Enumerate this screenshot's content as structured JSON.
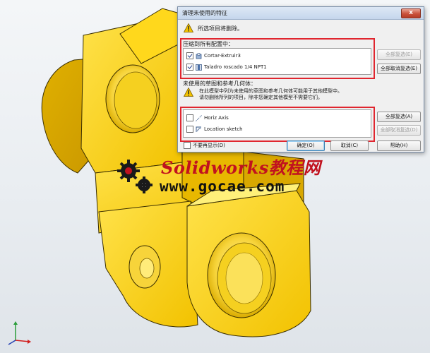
{
  "dialog": {
    "title": "清理未使用的特征",
    "close_symbol": "x",
    "warning_text": "所选项目将删除。",
    "section1_label": "压缩到所有配置中：",
    "section1_items": [
      {
        "label": "Cortar-Extruir3",
        "checked": true,
        "icon": "cut-extrude-icon"
      },
      {
        "label": "Taladro roscado 1/4 NPT1",
        "checked": true,
        "icon": "hole-wizard-icon"
      }
    ],
    "section1_select_all": "全部复选(E)",
    "section1_deselect_all": "全部取消复选(E)",
    "section2_label": "未使用的草图和参考几何体：",
    "section2_note_line1": "在此模型中列为未使用的草图和参考几何体可能用于其他模型中。",
    "section2_note_line2": "请勿删除所列的项目，除非您确定其他模型不需要它们。",
    "section2_items": [
      {
        "label": "Horiz Axis",
        "checked": false,
        "icon": "axis-icon"
      },
      {
        "label": "Location sketch",
        "checked": false,
        "icon": "sketch-icon"
      }
    ],
    "section2_select_all": "全部复选(A)",
    "section2_deselect_all": "全部取消复选(D)",
    "dont_show_label": "不要再显示(D)",
    "ok_label": "确定(O)",
    "cancel_label": "取消(C)",
    "help_label": "帮助(H)"
  },
  "watermark": {
    "title": "Solidworks教程网",
    "url": "www.gocae.com",
    "title_color": "#c1121f"
  },
  "colors": {
    "part_yellow": "#f2c200",
    "highlight_red": "#e0262f"
  }
}
